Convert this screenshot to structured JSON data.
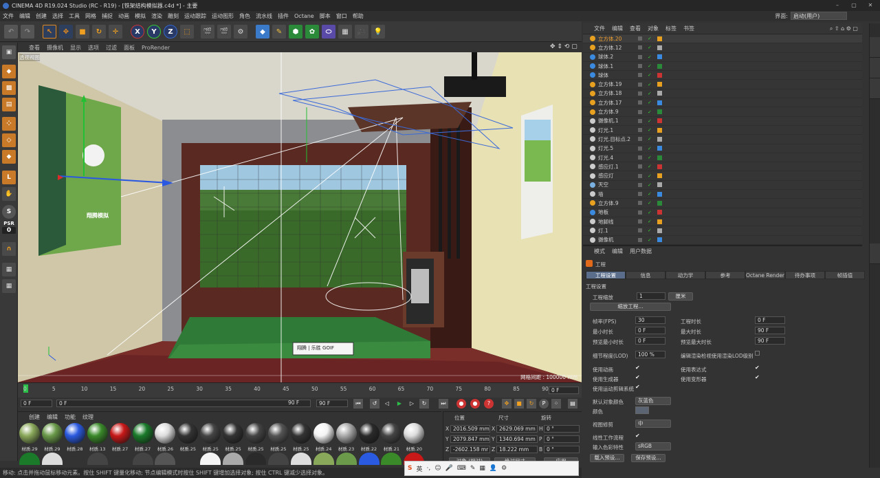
{
  "app": {
    "title": "CINEMA 4D R19.024 Studio (RC - R19) - [铁架结构模拟器.c4d *] - 主要",
    "layout_label": "界面:",
    "layout_value": "启动(用户)"
  },
  "menu": [
    "文件",
    "编辑",
    "创建",
    "选择",
    "工具",
    "网格",
    "捕捉",
    "动画",
    "模拟",
    "渲染",
    "雕刻",
    "运动跟踪",
    "运动图形",
    "角色",
    "流水线",
    "插件",
    "Octane",
    "脚本",
    "窗口",
    "帮助"
  ],
  "toolbar": {
    "axis_x": "X",
    "axis_y": "Y",
    "axis_z": "Z"
  },
  "lefttools": {
    "psr_label": "PSR",
    "psr_value": "0",
    "s_label": "S"
  },
  "viewport": {
    "menu": [
      "查看",
      "摄像机",
      "显示",
      "选项",
      "过滤",
      "面板",
      "ProRender"
    ],
    "view_name": "透视视图",
    "grid_info": "网格间距 : 100000 mm",
    "poster_left": "翔腾模拟",
    "banner": "翔腾 | 乐胜 GOIF"
  },
  "timeline": {
    "ticks": [
      "0",
      "5",
      "10",
      "15",
      "20",
      "25",
      "30",
      "35",
      "40",
      "45",
      "50",
      "55",
      "60",
      "65",
      "70",
      "75",
      "80",
      "85",
      "90"
    ],
    "end_frame": "0 F"
  },
  "anim": {
    "start": "0 F",
    "current": "0 F",
    "end": "90 F",
    "end2": "90 F"
  },
  "materials": {
    "menu": [
      "创建",
      "编辑",
      "功能",
      "纹理"
    ],
    "row1": [
      "材质.29",
      "材质.29",
      "材质.28",
      "材质.13",
      "材质.27",
      "材质.27",
      "材质.26",
      "材质.25",
      "材质.25",
      "材质.25",
      "材质.25",
      "材质.25",
      "材质.25",
      "材质.24",
      "材质.23",
      "材质.22",
      "材质.21",
      "材质.20"
    ]
  },
  "coords": {
    "head_pos": "位置",
    "head_size": "尺寸",
    "head_rot": "旋转",
    "x_pos": "2016.509 mm",
    "y_pos": "2079.847 mm",
    "z_pos": "-2602.158 mr",
    "x_size": "2629.069 mm",
    "y_size": "1340.694 mm",
    "z_size": "18.222 mm",
    "h": "0 °",
    "p": "0 °",
    "b": "0 °",
    "mode1": "对象 (相对)",
    "mode2": "绝对尺寸",
    "apply": "应用"
  },
  "objects": {
    "menu": [
      "文件",
      "编辑",
      "查看",
      "对象",
      "标签",
      "书签"
    ],
    "items": [
      "立方体.20",
      "立方体.12",
      "球体.2",
      "球体.1",
      "球体",
      "立方体.19",
      "立方体.18",
      "立方体.17",
      "立方体.9",
      "摄像机.1",
      "灯光.1",
      "灯光.目标点.2",
      "灯光.5",
      "灯光.4",
      "感应灯.1",
      "感应灯",
      "天空",
      "墙",
      "立方体.9",
      "地板",
      "地脚线",
      "灯.1",
      "摄像机"
    ]
  },
  "attributes": {
    "menu": [
      "模式",
      "编辑",
      "用户数据"
    ],
    "heading": "工程",
    "tabs": [
      "工程设置",
      "信息",
      "动力学",
      "参考",
      "Octane Render",
      "待办事项",
      "帧插值"
    ],
    "section": "工程设置",
    "scale_label": "工程缩放",
    "scale_value": "1",
    "scale_unit": "厘米",
    "scale_btn": "缩放工程...",
    "fps_label": "帧率(FPS)",
    "fps_value": "30",
    "duration_label": "工程时长",
    "duration_value": "0 F",
    "min_label": "最小时长",
    "min_value": "0 F",
    "max_label": "最大时长",
    "max_value": "90 F",
    "pmin_label": "预览最小时长",
    "pmin_value": "0 F",
    "pmax_label": "预览最大时长",
    "pmax_value": "90 F",
    "lod_label": "细节程度(LOD)",
    "lod_value": "100 %",
    "lod_render_label": "编辑渲染检视使用渲染LOD级别",
    "anim_label": "使用动画",
    "expr_label": "使用表达式",
    "gen_label": "使用生成器",
    "deform_label": "使用变形器",
    "motion_label": "使用运动剪辑系统",
    "defcolor_label": "默认对象颜色",
    "defcolor_value": "灰蓝色",
    "color_label": "颜色",
    "clip_label": "视图修剪",
    "clip_value": "中",
    "linear_label": "线性工作流程",
    "input_label": "输入色彩特性",
    "input_value": "sRGB",
    "load_btn": "载入预设...",
    "save_btn": "保存预设..."
  },
  "status": "移动: 点击并拖动鼠标移动元素。按住 SHIFT 键量化移动; 节点编辑模式时按住 SHIFT 键增加选择对象; 按住 CTRL 键减少选择对象。",
  "ime": {
    "lang": "英"
  }
}
